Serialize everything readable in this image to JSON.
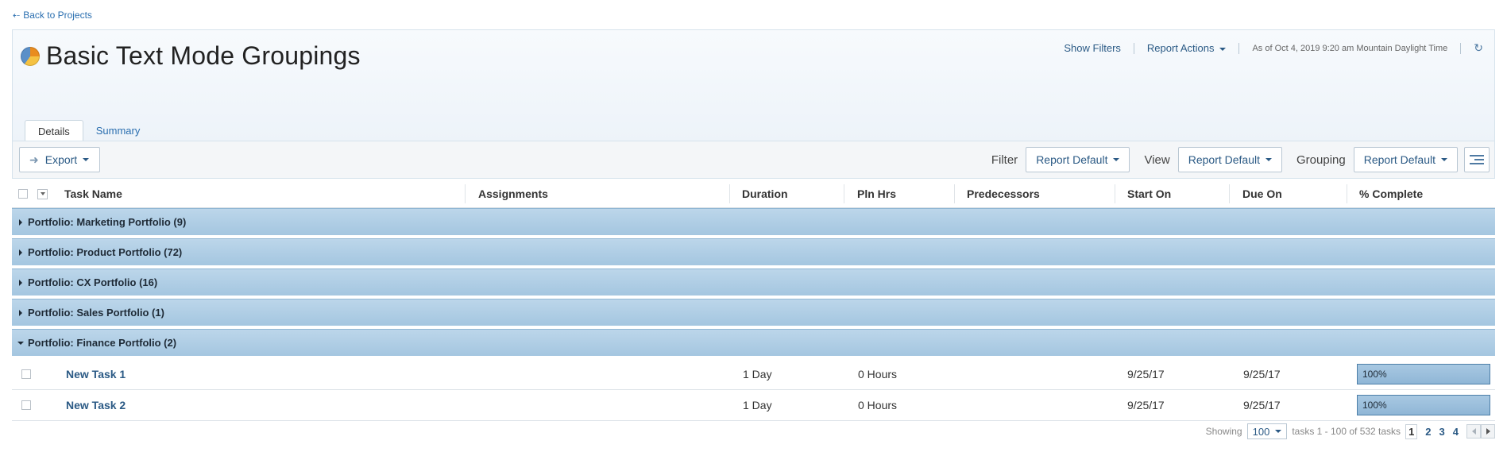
{
  "nav": {
    "back_label": "Back to Projects"
  },
  "report": {
    "title": "Basic Text Mode Groupings",
    "show_filters": "Show Filters",
    "report_actions": "Report Actions",
    "as_of": "As of Oct 4, 2019 9:20 am Mountain Daylight Time"
  },
  "tabs": [
    {
      "label": "Details",
      "active": true
    },
    {
      "label": "Summary",
      "active": false
    }
  ],
  "toolbar": {
    "export_label": "Export",
    "filter_label": "Filter",
    "filter_value": "Report Default",
    "view_label": "View",
    "view_value": "Report Default",
    "grouping_label": "Grouping",
    "grouping_value": "Report Default"
  },
  "columns": [
    "Task Name",
    "Assignments",
    "Duration",
    "Pln Hrs",
    "Predecessors",
    "Start On",
    "Due On",
    "% Complete"
  ],
  "groups": [
    {
      "label": "Portfolio: Marketing Portfolio (9)",
      "expanded": false
    },
    {
      "label": "Portfolio: Product Portfolio (72)",
      "expanded": false
    },
    {
      "label": "Portfolio: CX Portfolio (16)",
      "expanded": false
    },
    {
      "label": "Portfolio: Sales Portfolio (1)",
      "expanded": false
    },
    {
      "label": "Portfolio: Finance Portfolio (2)",
      "expanded": true
    }
  ],
  "tasks": [
    {
      "name": "New Task 1",
      "assignments": "",
      "duration": "1 Day",
      "pln_hrs": "0 Hours",
      "predecessors": "",
      "start_on": "9/25/17",
      "due_on": "9/25/17",
      "percent_complete": "100%",
      "progress": 1.0
    },
    {
      "name": "New Task 2",
      "assignments": "",
      "duration": "1 Day",
      "pln_hrs": "0 Hours",
      "predecessors": "",
      "start_on": "9/25/17",
      "due_on": "9/25/17",
      "percent_complete": "100%",
      "progress": 1.0
    }
  ],
  "pager": {
    "showing_label": "Showing",
    "page_size": "100",
    "range_text": "tasks 1 - 100 of 532 tasks",
    "pages": [
      "1",
      "2",
      "3",
      "4"
    ],
    "current_page": "1"
  },
  "colors": {
    "link": "#2b6fb0",
    "group_band": "#a4c6e0",
    "progress_fill": "#8fb6d6"
  }
}
